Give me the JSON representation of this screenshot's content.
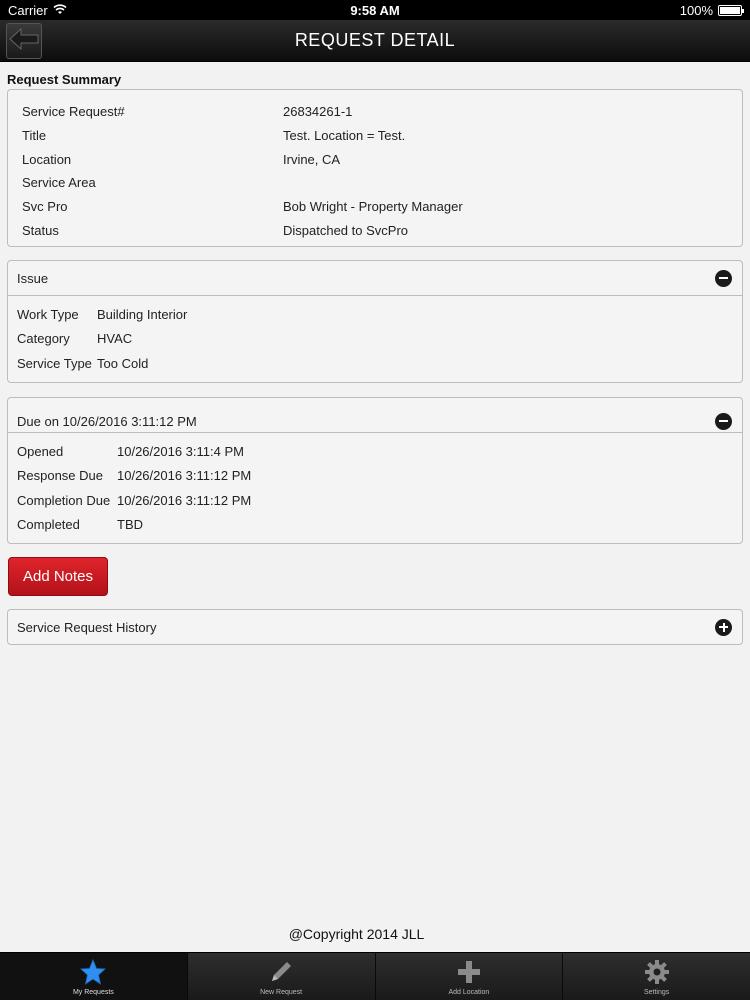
{
  "status_bar": {
    "carrier": "Carrier",
    "time": "9:58 AM",
    "battery": "100%",
    "battery_level": 1.0
  },
  "nav": {
    "title": "REQUEST DETAIL",
    "back_icon": "arrow-left-icon"
  },
  "summary": {
    "title": "Request Summary",
    "rows": [
      {
        "key": "Service Request#",
        "value": "26834261-1"
      },
      {
        "key": "Title",
        "value": "Test. Location = Test."
      },
      {
        "key": "Location",
        "value": "Irvine, CA"
      },
      {
        "key": "Service Area",
        "value": ""
      },
      {
        "key": "Svc Pro",
        "value": "Bob Wright - Property Manager"
      },
      {
        "key": "Status",
        "value": "Dispatched to SvcPro"
      }
    ]
  },
  "issue": {
    "header": "Issue",
    "toggle_icon": "minus-circle-icon",
    "rows": [
      {
        "key": "Work Type",
        "value": "Building Interior"
      },
      {
        "key": "Category",
        "value": "HVAC"
      },
      {
        "key": "Service Type",
        "value": "Too Cold"
      }
    ]
  },
  "due": {
    "header": "Due on 10/26/2016 3:11:12 PM",
    "toggle_icon": "minus-circle-icon",
    "rows": [
      {
        "key": "Opened",
        "value": "10/26/2016 3:11:4 PM"
      },
      {
        "key": "Response Due",
        "value": "10/26/2016 3:11:12 PM"
      },
      {
        "key": "Completion Due",
        "value": "10/26/2016 3:11:12 PM"
      },
      {
        "key": "Completed",
        "value": "TBD"
      }
    ]
  },
  "add_notes_label": "Add Notes",
  "history": {
    "header": "Service Request History",
    "toggle_icon": "plus-circle-icon"
  },
  "copyright": "@Copyright 2014 JLL",
  "tabs": [
    {
      "label": "My Requests",
      "icon": "star-icon",
      "active": true
    },
    {
      "label": "New Request",
      "icon": "pencil-icon",
      "active": false
    },
    {
      "label": "Add Location",
      "icon": "plus-icon",
      "active": false
    },
    {
      "label": "Settings",
      "icon": "gear-icon",
      "active": false
    }
  ],
  "colors": {
    "accent_red": "#d11a22",
    "active_star": "#2f8ff0"
  }
}
